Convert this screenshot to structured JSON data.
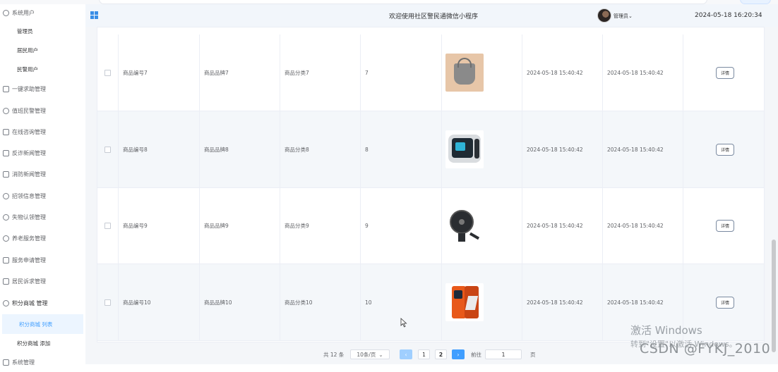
{
  "header": {
    "welcome": "欢迎使用社区警民通微信小程序",
    "admin_label": "管理员",
    "datetime": "2024-05-18 16:20:34"
  },
  "sidebar": {
    "items": [
      {
        "label": "系统用户",
        "icon": "user-icon"
      },
      {
        "label": "管理员",
        "sub": true
      },
      {
        "label": "居民用户",
        "sub": true
      },
      {
        "label": "民警用户",
        "sub": true
      },
      {
        "label": "一键求助管理",
        "icon": "box-icon"
      },
      {
        "label": "值班民警管理",
        "icon": "circle-icon"
      },
      {
        "label": "在线咨询管理",
        "icon": "grid-icon"
      },
      {
        "label": "反诈新闻管理",
        "icon": "home-icon"
      },
      {
        "label": "消防新闻管理",
        "icon": "book-icon"
      },
      {
        "label": "招领信息管理",
        "icon": "share-icon"
      },
      {
        "label": "失物认领管理",
        "icon": "chat-icon"
      },
      {
        "label": "养老服务管理",
        "icon": "people-icon"
      },
      {
        "label": "服务申请管理",
        "icon": "list-icon"
      },
      {
        "label": "居民诉求管理",
        "icon": "form-icon"
      },
      {
        "label": "积分商城 管理",
        "icon": "cart-icon"
      },
      {
        "label": "积分商城 列表",
        "sub": true,
        "active": true
      },
      {
        "label": "积分商城 添加",
        "sub": true
      },
      {
        "label": "系统管理",
        "icon": "monitor-icon"
      }
    ]
  },
  "table": {
    "rows": [
      {
        "code": "商品编号7",
        "brand": "商品品牌7",
        "category": "商品分类7",
        "points": "7",
        "image": "bag-image",
        "created": "2024-05-18 15:40:42",
        "updated": "2024-05-18 15:40:42",
        "action": "详情"
      },
      {
        "code": "商品编号8",
        "brand": "商品品牌8",
        "category": "商品分类8",
        "points": "8",
        "image": "computer-image",
        "created": "2024-05-18 15:40:42",
        "updated": "2024-05-18 15:40:42",
        "action": "详情"
      },
      {
        "code": "商品编号9",
        "brand": "商品品牌9",
        "category": "商品分类9",
        "points": "9",
        "image": "fan-image",
        "created": "2024-05-18 15:40:42",
        "updated": "2024-05-18 15:40:42",
        "action": "详情"
      },
      {
        "code": "商品编号10",
        "brand": "商品品牌10",
        "category": "商品分类10",
        "points": "10",
        "image": "phone-image",
        "created": "2024-05-18 15:40:42",
        "updated": "2024-05-18 15:40:42",
        "action": "详情"
      }
    ]
  },
  "pagination": {
    "total": "共 12 条",
    "page_size": "10条/页",
    "pages": [
      "1",
      "2"
    ],
    "current_page": "2",
    "goto_label": "前往",
    "goto_value": "1",
    "page_suffix": "页"
  },
  "watermark": {
    "line1": "激活 Windows",
    "line2": "转到\"设置\"以激活 Windows。",
    "csdn": "CSDN @FYKJ_2010"
  },
  "colors": {
    "accent": "#409eff",
    "header_bg": "#f2f6fb",
    "alt_row": "#f4f7fa"
  }
}
